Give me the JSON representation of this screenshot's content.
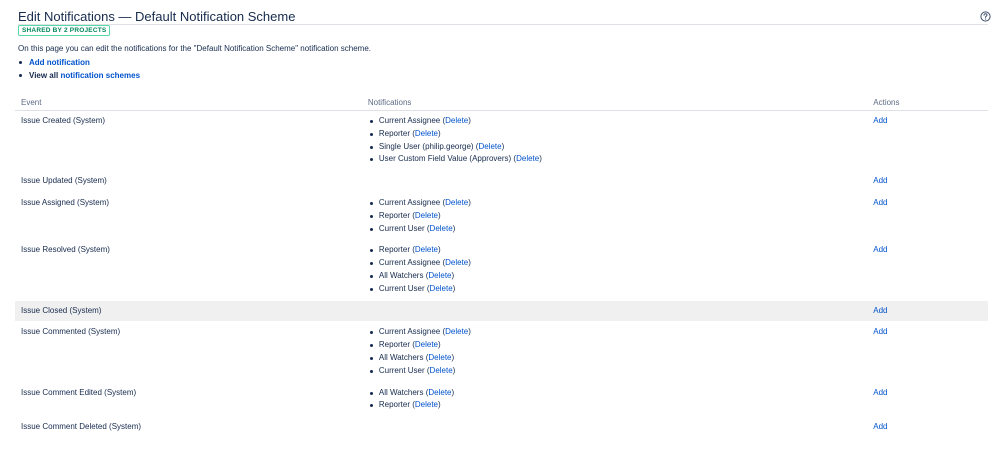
{
  "page": {
    "title": "Edit Notifications — Default Notification Scheme",
    "shared_badge": "SHARED BY 2 PROJECTS",
    "intro": "On this page you can edit the notifications for the \"Default Notification Scheme\" notification scheme.",
    "help_icon": "question-circle-icon"
  },
  "links": {
    "add_notification": "Add notification",
    "view_all_prefix": "View all ",
    "notification_schemes": "notification schemes"
  },
  "table": {
    "headers": {
      "event": "Event",
      "notifications": "Notifications",
      "actions": "Actions"
    },
    "add_label": "Add",
    "delete_label": "Delete",
    "rows": [
      {
        "event": "Issue Created (System)",
        "notifications": [
          "Current Assignee",
          "Reporter",
          "Single User (philip.george)",
          "User Custom Field Value (Approvers)"
        ]
      },
      {
        "event": "Issue Updated (System)",
        "notifications": []
      },
      {
        "event": "Issue Assigned (System)",
        "notifications": [
          "Current Assignee",
          "Reporter",
          "Current User"
        ]
      },
      {
        "event": "Issue Resolved (System)",
        "notifications": [
          "Reporter",
          "Current Assignee",
          "All Watchers",
          "Current User"
        ]
      },
      {
        "event": "Issue Closed (System)",
        "notifications": [],
        "highlighted": true
      },
      {
        "event": "Issue Commented (System)",
        "notifications": [
          "Current Assignee",
          "Reporter",
          "All Watchers",
          "Current User"
        ]
      },
      {
        "event": "Issue Comment Edited (System)",
        "notifications": [
          "All Watchers",
          "Reporter"
        ]
      },
      {
        "event": "Issue Comment Deleted (System)",
        "notifications": []
      }
    ]
  },
  "colors": {
    "link": "#0052cc",
    "text": "#172b4d",
    "muted": "#5e6c84",
    "badge_green": "#00875a",
    "highlight_row": "#f0f0f0"
  }
}
